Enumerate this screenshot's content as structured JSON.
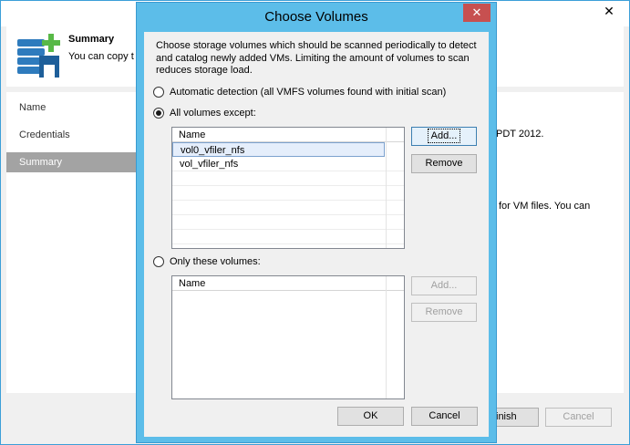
{
  "background": {
    "close_glyph": "✕",
    "header": {
      "title": "Summary",
      "subtitle": "You can copy t"
    },
    "steps": [
      "Name",
      "Credentials",
      "Summary"
    ],
    "content_fragments": {
      "line1": "PDT 2012.",
      "line2": "for VM files. You can"
    },
    "footer": {
      "finish_label": "inish",
      "cancel_label": "Cancel"
    }
  },
  "dialog": {
    "title": "Choose Volumes",
    "close_glyph": "✕",
    "description": "Choose storage volumes which should be scanned periodically to detect and catalog newly added VMs. Limiting the amount of volumes to scan reduces storage load.",
    "options": {
      "automatic": "Automatic detection (all VMFS volumes found with initial scan)",
      "all_except": "All volumes except:",
      "only_these": "Only these volumes:"
    },
    "selected_option": "all_except",
    "except_list": {
      "header": "Name",
      "items": [
        "vol0_vfiler_nfs",
        "vol_vfiler_nfs"
      ]
    },
    "only_list": {
      "header": "Name",
      "items": []
    },
    "buttons": {
      "add": "Add...",
      "remove": "Remove",
      "add_disabled": "Add...",
      "remove_disabled": "Remove",
      "ok": "OK",
      "cancel": "Cancel"
    }
  }
}
